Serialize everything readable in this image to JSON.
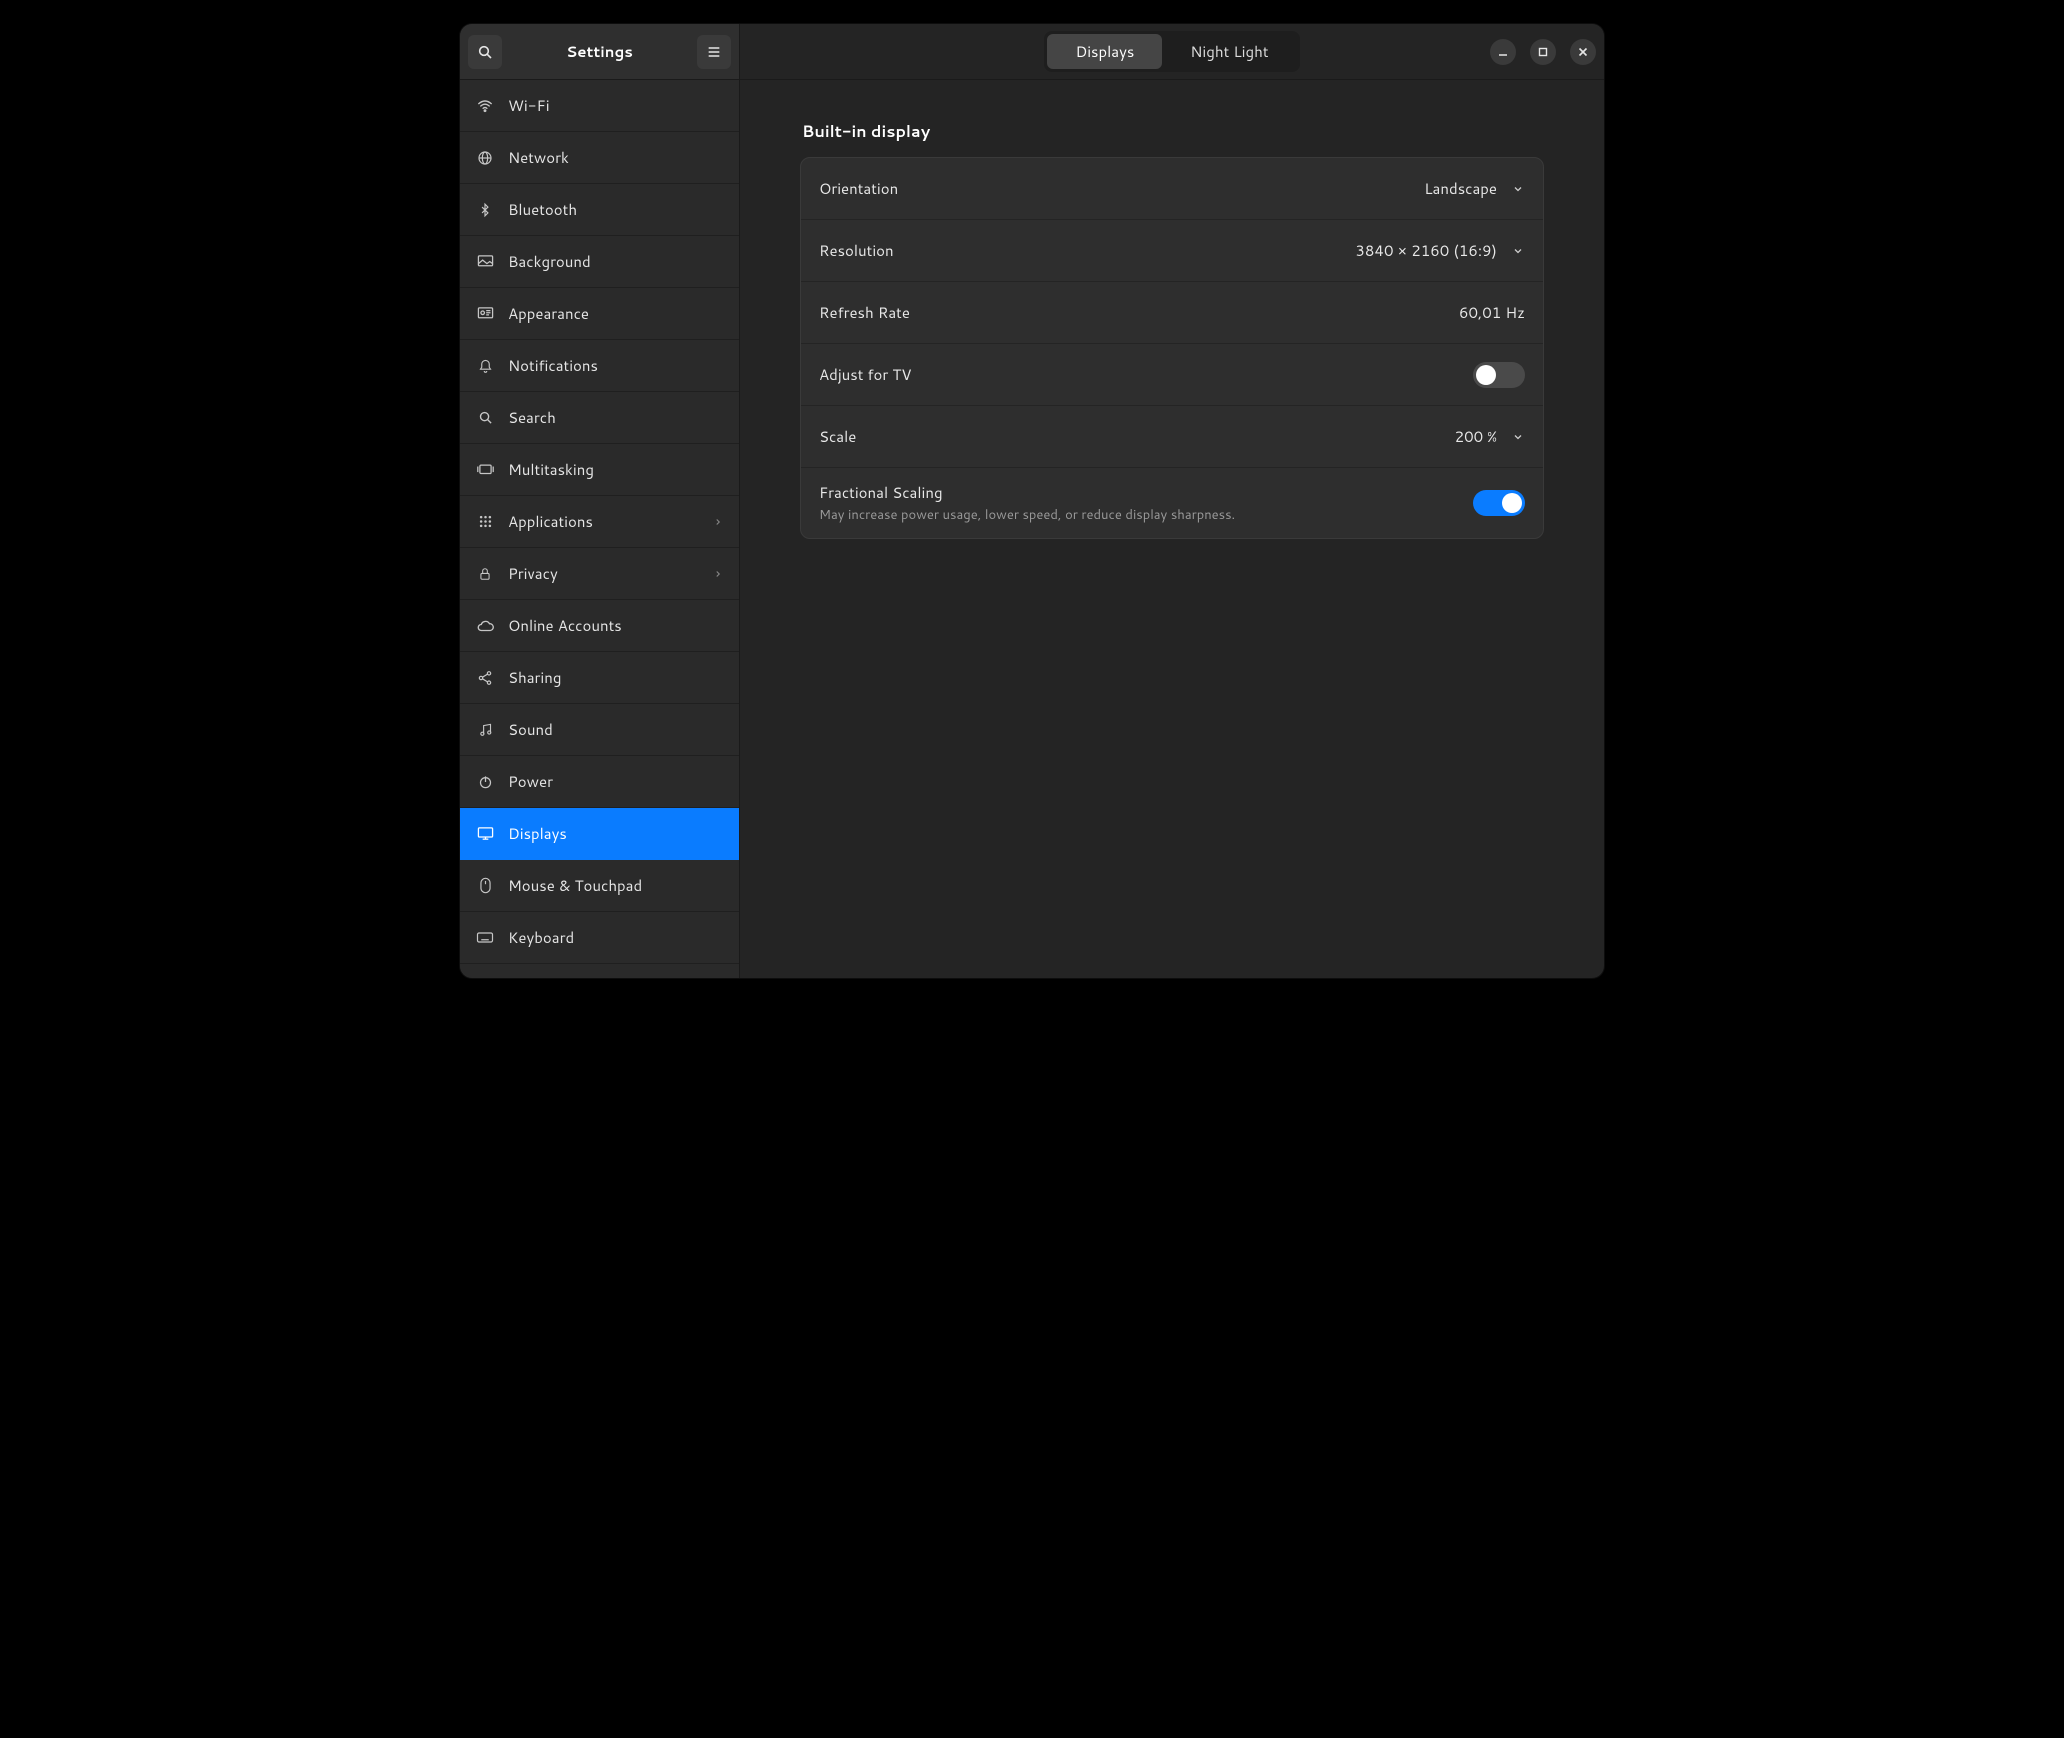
{
  "header": {
    "title": "Settings",
    "tabs": [
      {
        "label": "Displays",
        "active": true
      },
      {
        "label": "Night Light",
        "active": false
      }
    ]
  },
  "sidebar": {
    "items": [
      {
        "icon": "wifi",
        "label": "Wi-Fi"
      },
      {
        "icon": "globe",
        "label": "Network"
      },
      {
        "icon": "bluetooth",
        "label": "Bluetooth"
      },
      {
        "icon": "background",
        "label": "Background"
      },
      {
        "icon": "appearance",
        "label": "Appearance"
      },
      {
        "icon": "bell",
        "label": "Notifications"
      },
      {
        "icon": "search",
        "label": "Search"
      },
      {
        "icon": "multitask",
        "label": "Multitasking"
      },
      {
        "icon": "apps",
        "label": "Applications",
        "chevron": true
      },
      {
        "icon": "lock",
        "label": "Privacy",
        "chevron": true
      },
      {
        "icon": "cloud",
        "label": "Online Accounts"
      },
      {
        "icon": "share",
        "label": "Sharing"
      },
      {
        "icon": "music",
        "label": "Sound"
      },
      {
        "icon": "power",
        "label": "Power"
      },
      {
        "icon": "displays",
        "label": "Displays",
        "selected": true
      },
      {
        "icon": "mouse",
        "label": "Mouse & Touchpad"
      },
      {
        "icon": "keyboard",
        "label": "Keyboard"
      }
    ]
  },
  "content": {
    "section_title": "Built-in display",
    "rows": {
      "orientation": {
        "label": "Orientation",
        "value": "Landscape",
        "dropdown": true
      },
      "resolution": {
        "label": "Resolution",
        "value": "3840 × 2160 (16:9)",
        "dropdown": true
      },
      "refresh": {
        "label": "Refresh Rate",
        "value": "60,01 Hz",
        "dropdown": false
      },
      "adjust_tv": {
        "label": "Adjust for TV",
        "switch": "off"
      },
      "scale": {
        "label": "Scale",
        "value": "200 %",
        "dropdown": true
      },
      "fractional": {
        "label": "Fractional Scaling",
        "sub": "May increase power usage, lower speed, or reduce display sharpness.",
        "switch": "on"
      }
    }
  }
}
